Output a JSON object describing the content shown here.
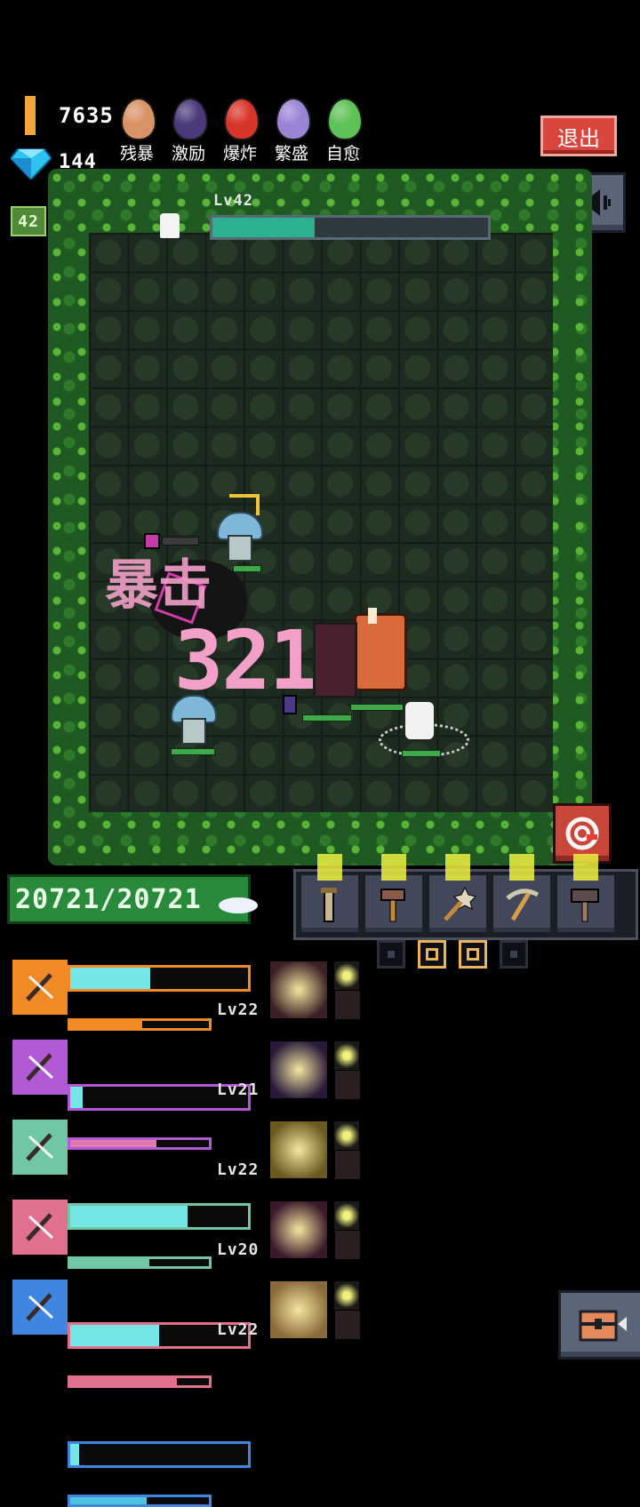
{
  "hud": {
    "gold": "7635",
    "gems": "144",
    "level": "42",
    "buffs": [
      {
        "label": "残暴",
        "color": "#d89366",
        "icon": "brown-egg-icon"
      },
      {
        "label": "激励",
        "color": "#4a3a7a",
        "icon": "dark-purple-egg-icon"
      },
      {
        "label": "爆炸",
        "color": "#d8352a",
        "icon": "red-egg-icon"
      },
      {
        "label": "繁盛",
        "color": "#9a84d6",
        "icon": "lavender-egg-icon"
      },
      {
        "label": "自愈",
        "color": "#5ec256",
        "icon": "green-egg-icon"
      }
    ],
    "exit_label": "退出"
  },
  "wave": {
    "label": "Lv42",
    "progress": 0.37
  },
  "battle": {
    "crit_text": "暴击",
    "damage_text": "3210"
  },
  "player": {
    "hp_text": "20721/20721"
  },
  "weapons": [
    {
      "icon": "scroll-icon"
    },
    {
      "icon": "hammer-icon"
    },
    {
      "icon": "star-wand-icon"
    },
    {
      "icon": "pickaxe-icon"
    },
    {
      "icon": "mallet-icon"
    }
  ],
  "pages": [
    false,
    true,
    true,
    false
  ],
  "heroes": [
    {
      "name": "hero-1",
      "lv": "Lv22",
      "frame": "#f08a26",
      "energy": 0.45,
      "sub": 0.52,
      "subcolor": "#f08a26"
    },
    {
      "name": "hero-2",
      "lv": "Lv21",
      "frame": "#b25ad6",
      "energy": 0.07,
      "sub": 0.62,
      "subcolor": "#e07ab0"
    },
    {
      "name": "hero-3",
      "lv": "Lv22",
      "frame": "#6fc7a6",
      "energy": 0.66,
      "sub": 0.57,
      "subcolor": "#6fc7a6"
    },
    {
      "name": "hero-4",
      "lv": "Lv20",
      "frame": "#e0708e",
      "energy": 0.5,
      "sub": 0.77,
      "subcolor": "#e0708e"
    },
    {
      "name": "hero-5",
      "lv": "Lv22",
      "frame": "#3f86e0",
      "energy": 0.05,
      "sub": 0.55,
      "subcolor": "#4fc4e0"
    }
  ]
}
